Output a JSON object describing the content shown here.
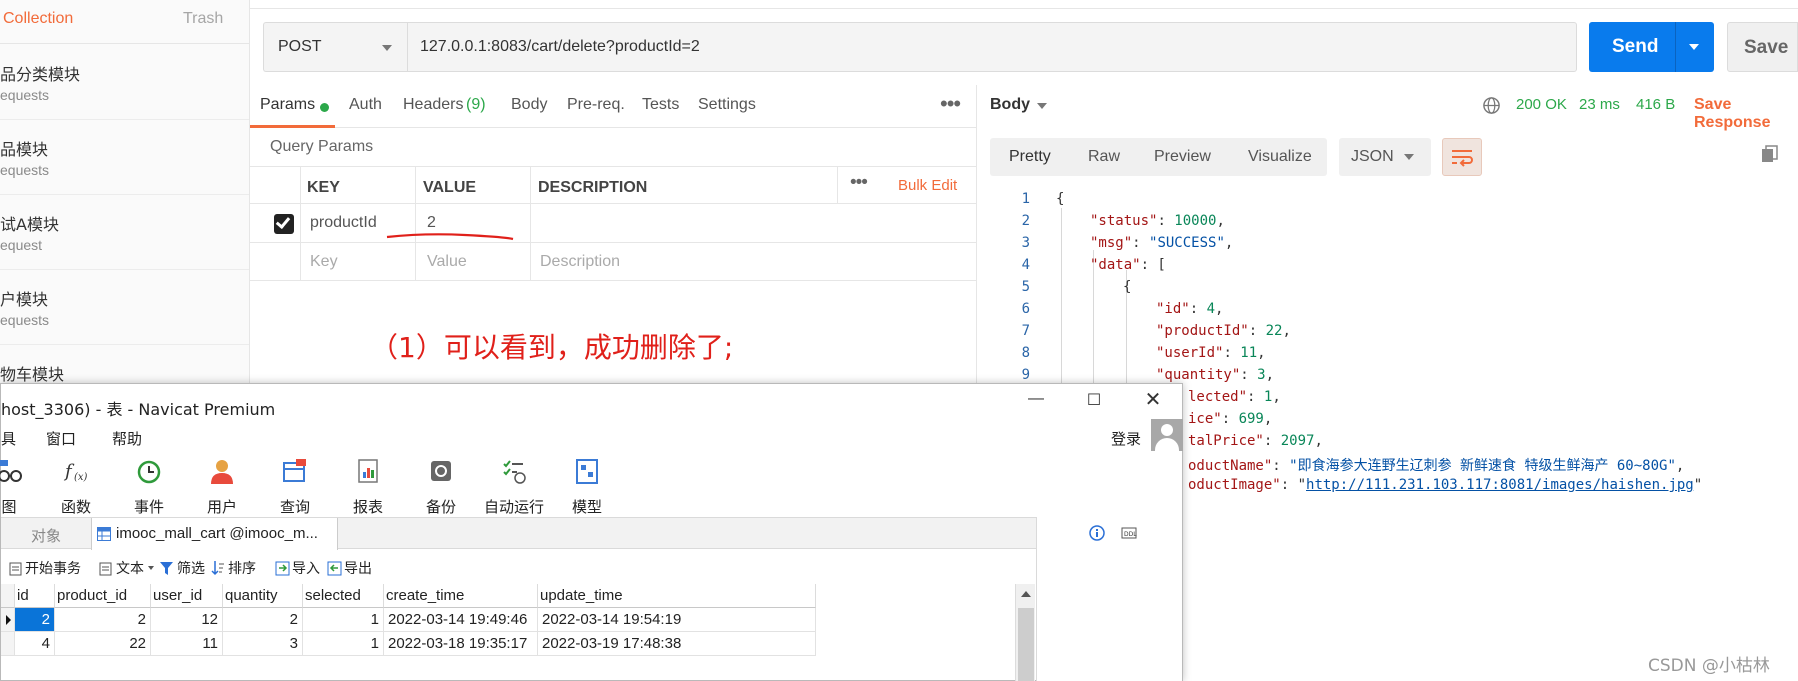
{
  "postman": {
    "sidebar": {
      "tabs": {
        "active": "Collection",
        "other": "Trash"
      },
      "items": [
        {
          "name": "品分类模块",
          "sub": "equests"
        },
        {
          "name": "品模块",
          "sub": "equests"
        },
        {
          "name": "试A模块",
          "sub": "equest"
        },
        {
          "name": "户模块",
          "sub": "equests"
        },
        {
          "name": "物车模块",
          "sub": ""
        }
      ]
    },
    "request": {
      "method": "POST",
      "url": "127.0.0.1:8083/cart/delete?productId=2",
      "send_label": "Send",
      "save_label": "Save"
    },
    "tabs": {
      "params": "Params",
      "auth": "Auth",
      "headers": "Headers",
      "headers_count": "(9)",
      "body": "Body",
      "prereq": "Pre-req.",
      "tests": "Tests",
      "settings": "Settings",
      "more": "•••"
    },
    "query_params": {
      "title": "Query Params",
      "headers": {
        "key": "KEY",
        "value": "VALUE",
        "description": "DESCRIPTION"
      },
      "bulk_edit": "Bulk Edit",
      "more": "•••",
      "row": {
        "key": "productId",
        "value": "2",
        "checked": true
      },
      "placeholders": {
        "key": "Key",
        "value": "Value",
        "description": "Description"
      }
    },
    "response": {
      "body_label": "Body",
      "status": "200 OK",
      "time": "23 ms",
      "size": "416 B",
      "save_response": "Save Response",
      "view_tabs": [
        "Pretty",
        "Raw",
        "Preview",
        "Visualize"
      ],
      "format": "JSON",
      "line_numbers": [
        "1",
        "2",
        "3",
        "4",
        "5",
        "6",
        "7",
        "8",
        "9"
      ],
      "json": {
        "status_key": "\"status\"",
        "status_val": "10000",
        "msg_key": "\"msg\"",
        "msg_val": "\"SUCCESS\"",
        "data_key": "\"data\"",
        "id_key": "\"id\"",
        "id_val": "4",
        "productId_key": "\"productId\"",
        "productId_val": "22",
        "userId_key": "\"userId\"",
        "userId_val": "11",
        "quantity_key": "\"quantity\"",
        "quantity_val": "3",
        "selected_key": "lected\"",
        "selected_val": "1",
        "price_key": "ice\"",
        "price_val": "699",
        "total_key": "talPrice\"",
        "total_val": "2097",
        "pname_key": "oductName\"",
        "pname_val": "\"即食海参大连野生辽刺参 新鲜速食 特级生鲜海产 60~80G\"",
        "pimg_key": "oductImage\"",
        "pimg_val": "http://111.231.103.117:8081/images/haishen.jpg"
      }
    }
  },
  "annotation": "（1）可以看到，成功删除了;",
  "watermark": "CSDN @小枯林",
  "navicat": {
    "title": "host_3306) - 表 - Navicat Premium",
    "menu": [
      "具",
      "窗口",
      "帮助"
    ],
    "login": "登录",
    "tools": [
      "图",
      "函数",
      "事件",
      "用户",
      "查询",
      "报表",
      "备份",
      "自动运行",
      "模型"
    ],
    "tabs": {
      "objects": "对象",
      "table": "imooc_mall_cart @imooc_m..."
    },
    "toolbar": {
      "begin": "开始事务",
      "text": "文本",
      "filter": "筛选",
      "sort": "排序",
      "import": "导入",
      "export": "导出"
    },
    "columns": [
      "id",
      "product_id",
      "user_id",
      "quantity",
      "selected",
      "create_time",
      "update_time"
    ],
    "rows": [
      [
        "2",
        "2",
        "12",
        "2",
        "1",
        "2022-03-14 19:49:46",
        "2022-03-14 19:54:19"
      ],
      [
        "4",
        "22",
        "11",
        "3",
        "1",
        "2022-03-18 19:35:17",
        "2022-03-19 17:48:38"
      ]
    ]
  },
  "colors": {
    "accent": "#f26b3a",
    "send": "#097bed",
    "ok": "#2ca84a",
    "annotation": "#e0201a"
  }
}
